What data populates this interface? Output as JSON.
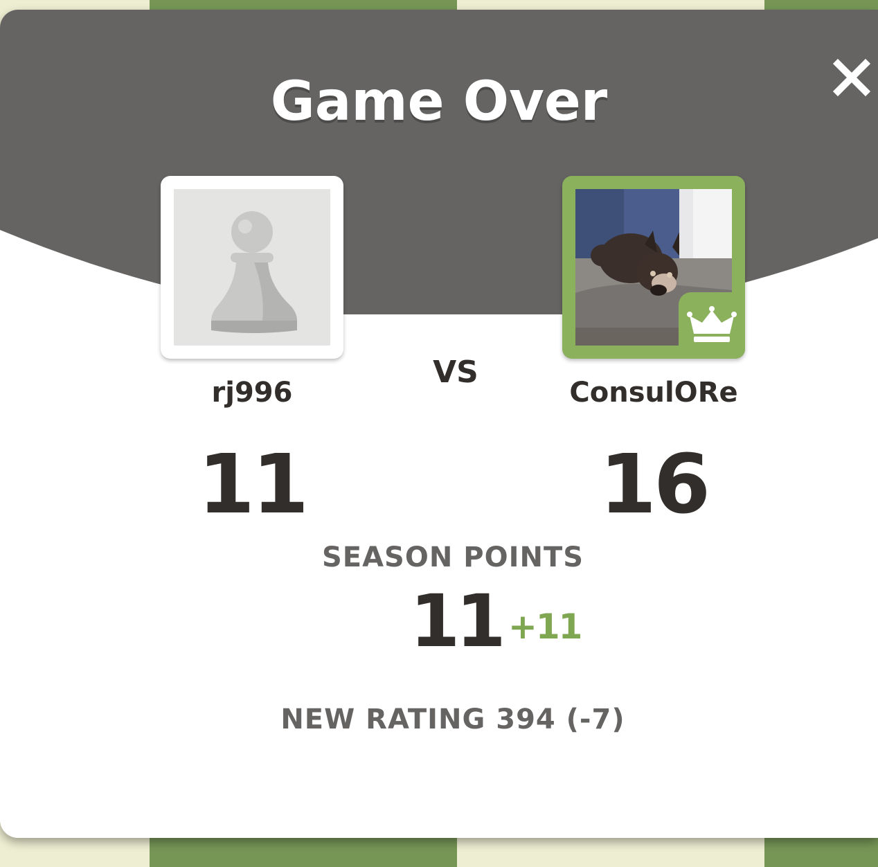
{
  "colors": {
    "header_gray": "#666463",
    "winner_green": "#8bb15c",
    "delta_green": "#7fa650",
    "text_dark": "#312e2b",
    "text_gray": "#666463",
    "board_light": "#eeeed2",
    "board_green": "#769656"
  },
  "modal": {
    "title": "Game Over",
    "close_icon": "close-icon"
  },
  "players": {
    "left": {
      "name": "rj996",
      "score": "11",
      "avatar_icon": "pawn-icon"
    },
    "right": {
      "name": "ConsulORe",
      "score": "16",
      "avatar_icon": "dog-photo",
      "badge_icon": "crown-icon"
    }
  },
  "vs_label": "VS",
  "season": {
    "label": "SEASON POINTS",
    "value": "11",
    "delta": "+11"
  },
  "rating_text": "NEW RATING 394 (-7)"
}
